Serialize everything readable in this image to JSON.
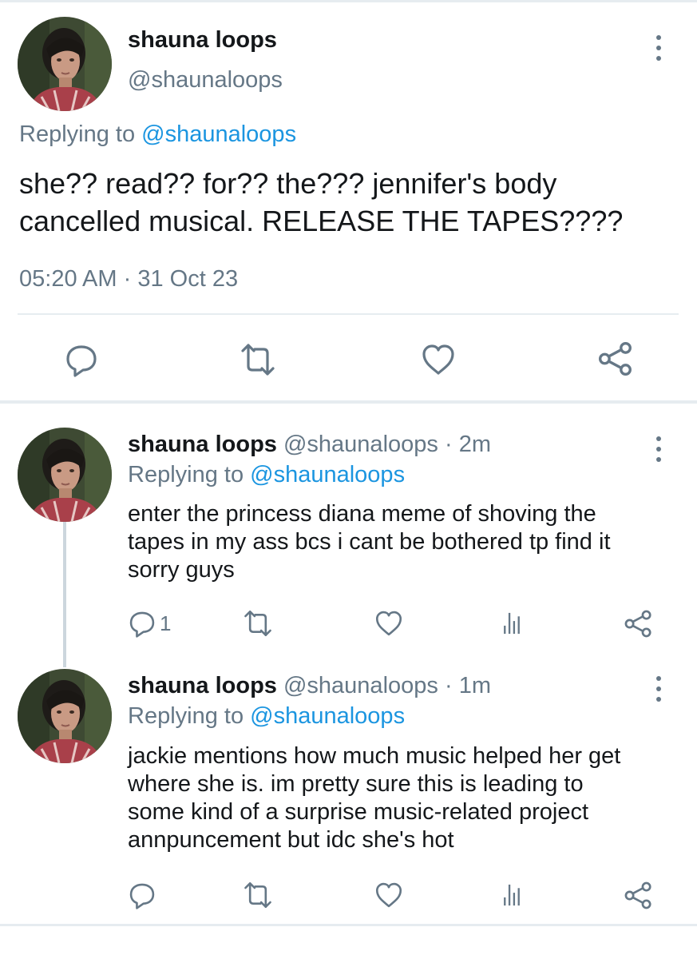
{
  "main_tweet": {
    "display_name": "shauna loops",
    "handle": "@shaunaloops",
    "replying_prefix": "Replying to",
    "replying_to": "@shaunaloops",
    "text": "she?? read?? for?? the??? jennifer's body cancelled musical. RELEASE THE TAPES????",
    "time": "05:20 AM",
    "separator": "·",
    "date": "31 Oct 23",
    "actions": [
      "reply-icon",
      "retweet-icon",
      "like-icon",
      "share-icon"
    ]
  },
  "replies": [
    {
      "display_name": "shauna loops",
      "handle": "@shaunaloops",
      "separator": "·",
      "age": "2m",
      "replying_prefix": "Replying to",
      "replying_to": "@shaunaloops",
      "lines": [
        "enter the princess diana meme of shoving the",
        "tapes in my ass bcs i cant be bothered tp find it",
        "sorry guys"
      ],
      "reply_count": "1"
    },
    {
      "display_name": "shauna loops",
      "handle": "@shaunaloops",
      "separator": "·",
      "age": "1m",
      "replying_prefix": "Replying to",
      "replying_to": "@shaunaloops",
      "lines": [
        "jackie mentions how much music helped her get",
        "where she is. im pretty sure this is leading to",
        "some kind of a surprise music-related project",
        "annpuncement but idc she's hot"
      ],
      "reply_count": ""
    }
  ],
  "colors": {
    "text": "#14171a",
    "secondary": "#657786",
    "link": "#1b95e0",
    "divider": "#e6ecf0",
    "thread_line": "#ccd6dd"
  }
}
